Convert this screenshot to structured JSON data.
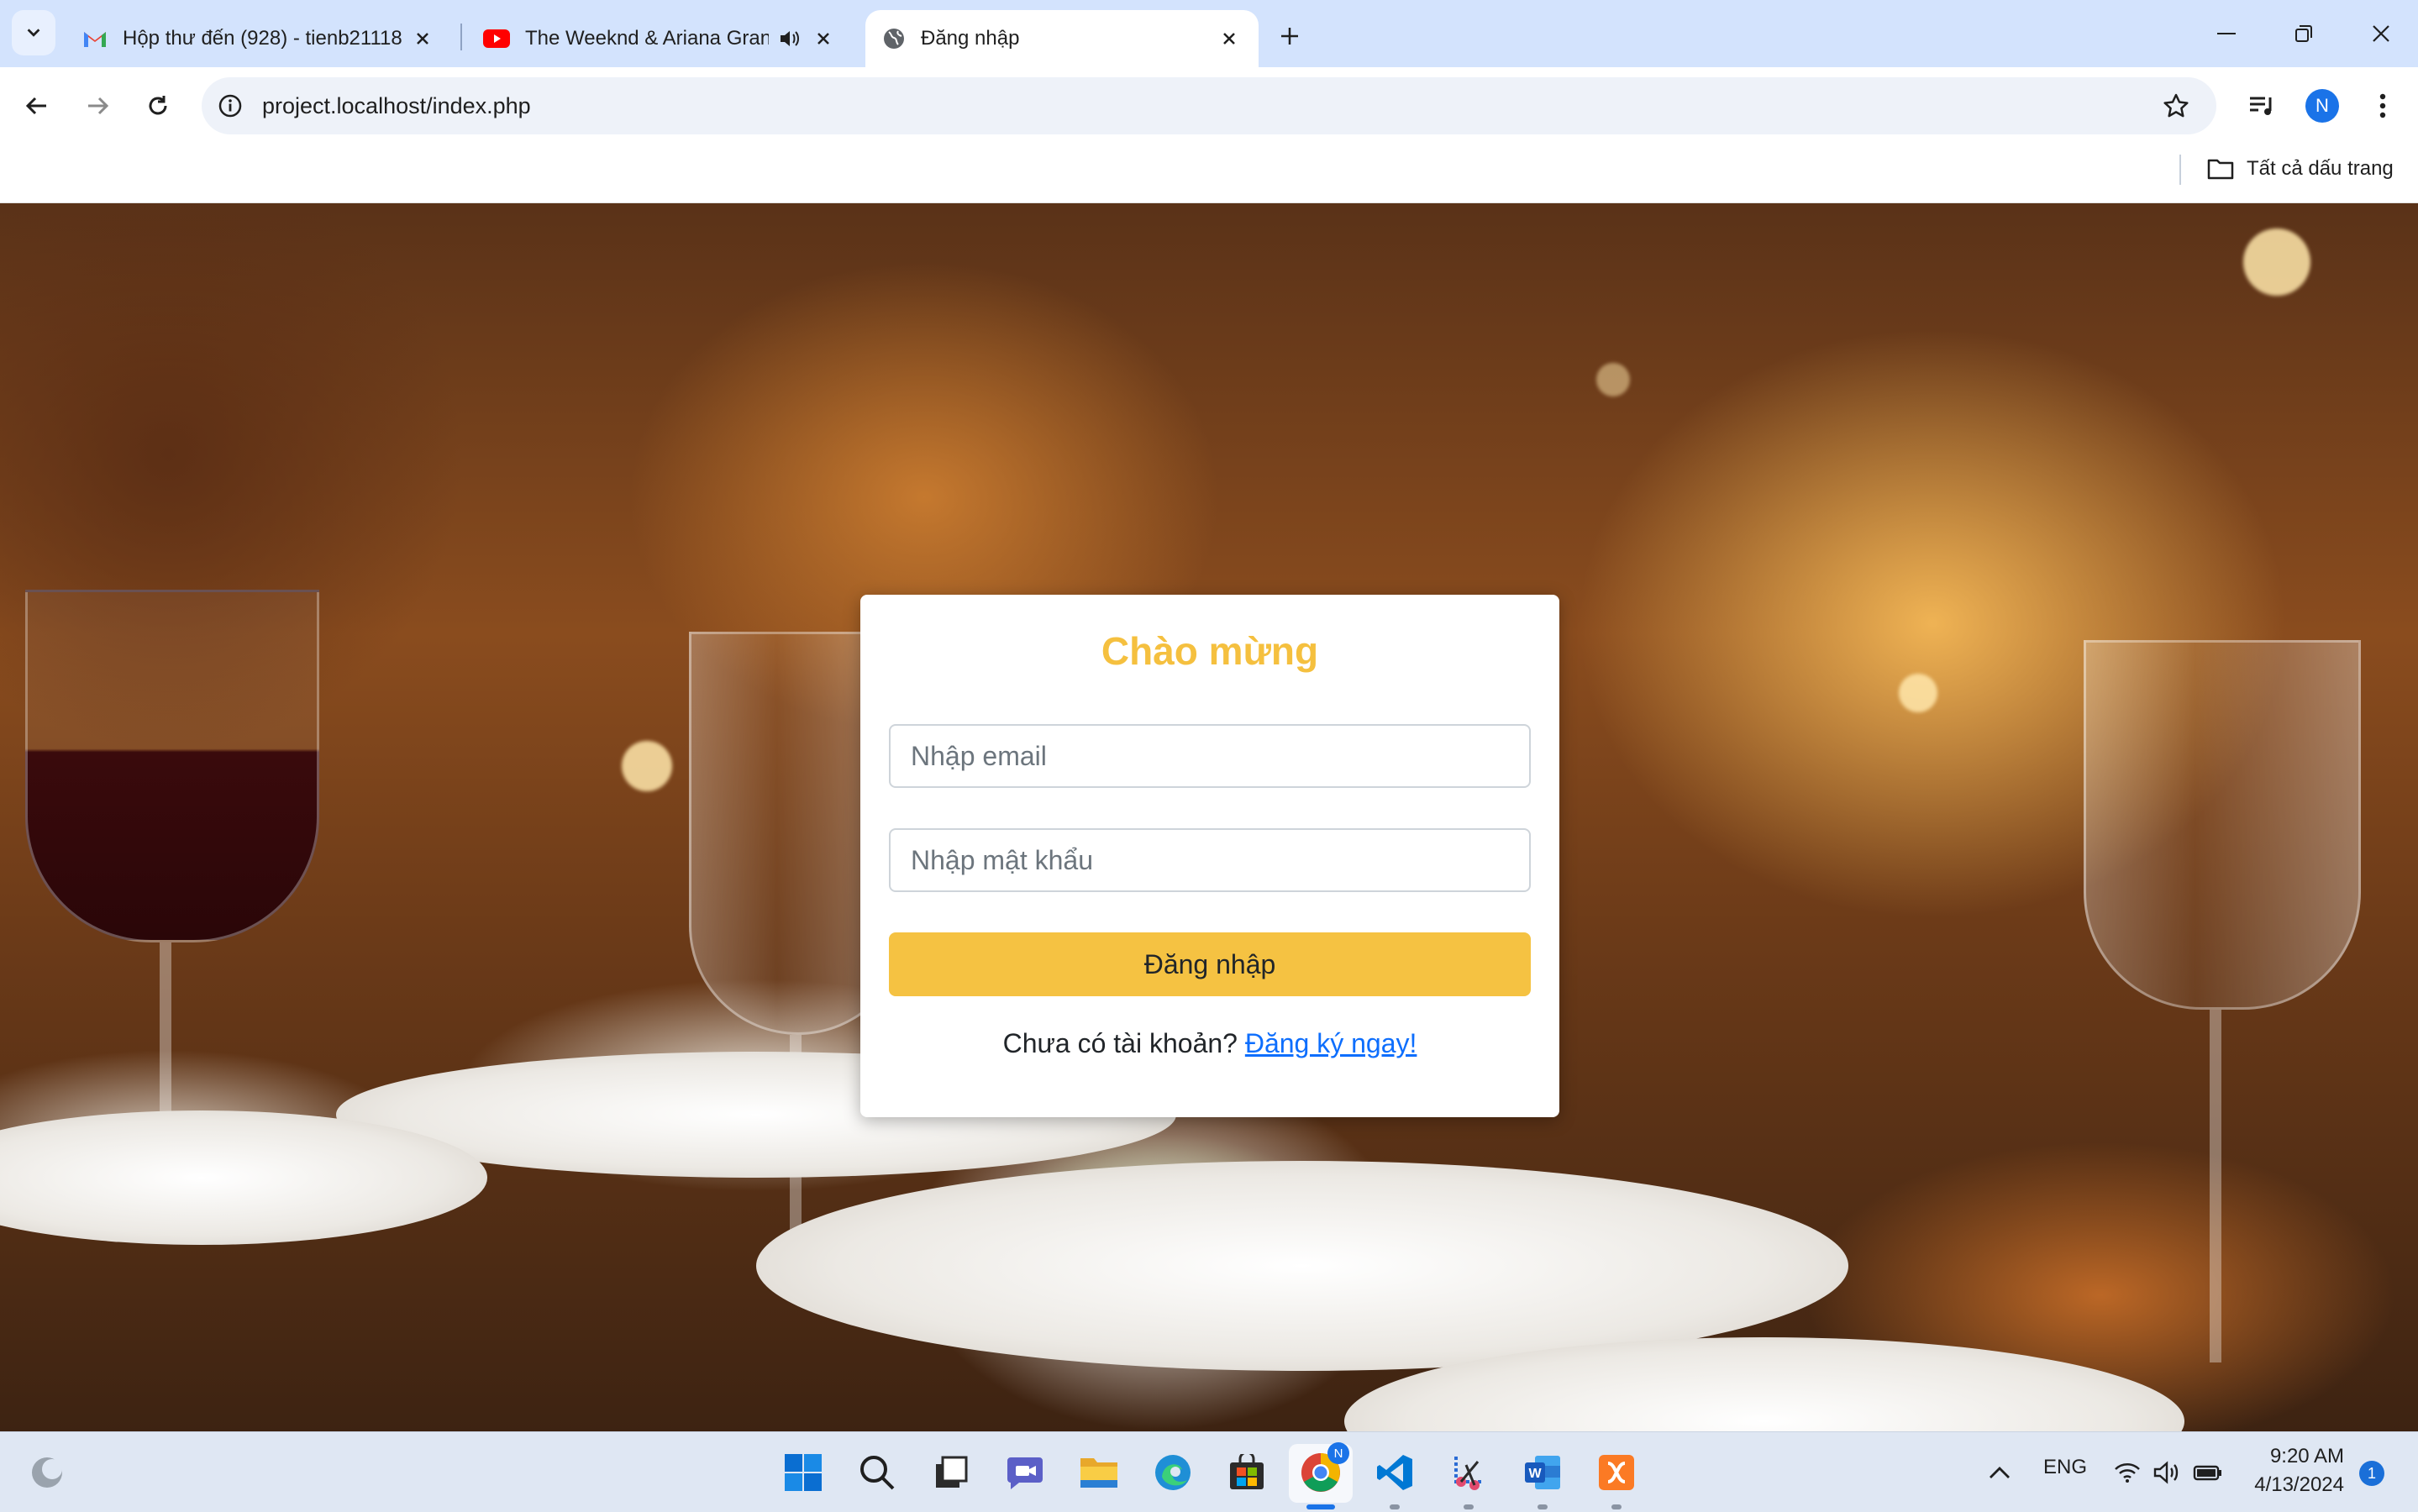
{
  "browser": {
    "tabs": [
      {
        "title": "Hộp thư đến (928) - tienb21118",
        "icon": "gmail-icon"
      },
      {
        "title": "The Weeknd & Ariana Grande",
        "icon": "youtube-icon",
        "audio": true
      },
      {
        "title": "Đăng nhập",
        "icon": "globe-icon",
        "active": true
      }
    ],
    "url": "project.localhost/index.php",
    "profile_initial": "N",
    "bookmarks_all_label": "Tất cả dấu trang"
  },
  "login": {
    "title": "Chào mừng",
    "email_placeholder": "Nhập email",
    "password_placeholder": "Nhập mật khẩu",
    "submit_label": "Đăng nhập",
    "signup_prompt": "Chưa có tài khoản?",
    "signup_link": "Đăng ký ngay!",
    "accent_color": "#f5c03f",
    "link_color": "#0d6efd"
  },
  "taskbar": {
    "language": "ENG",
    "time": "9:20 AM",
    "date": "4/13/2024",
    "notifications": "1",
    "chrome_badge": "N",
    "apps": [
      "start-icon",
      "search-icon",
      "task-view-icon",
      "chat-icon",
      "file-explorer-icon",
      "edge-icon",
      "store-icon",
      "chrome-icon",
      "vscode-icon",
      "snipping-tool-icon",
      "word-icon",
      "xampp-icon"
    ]
  }
}
